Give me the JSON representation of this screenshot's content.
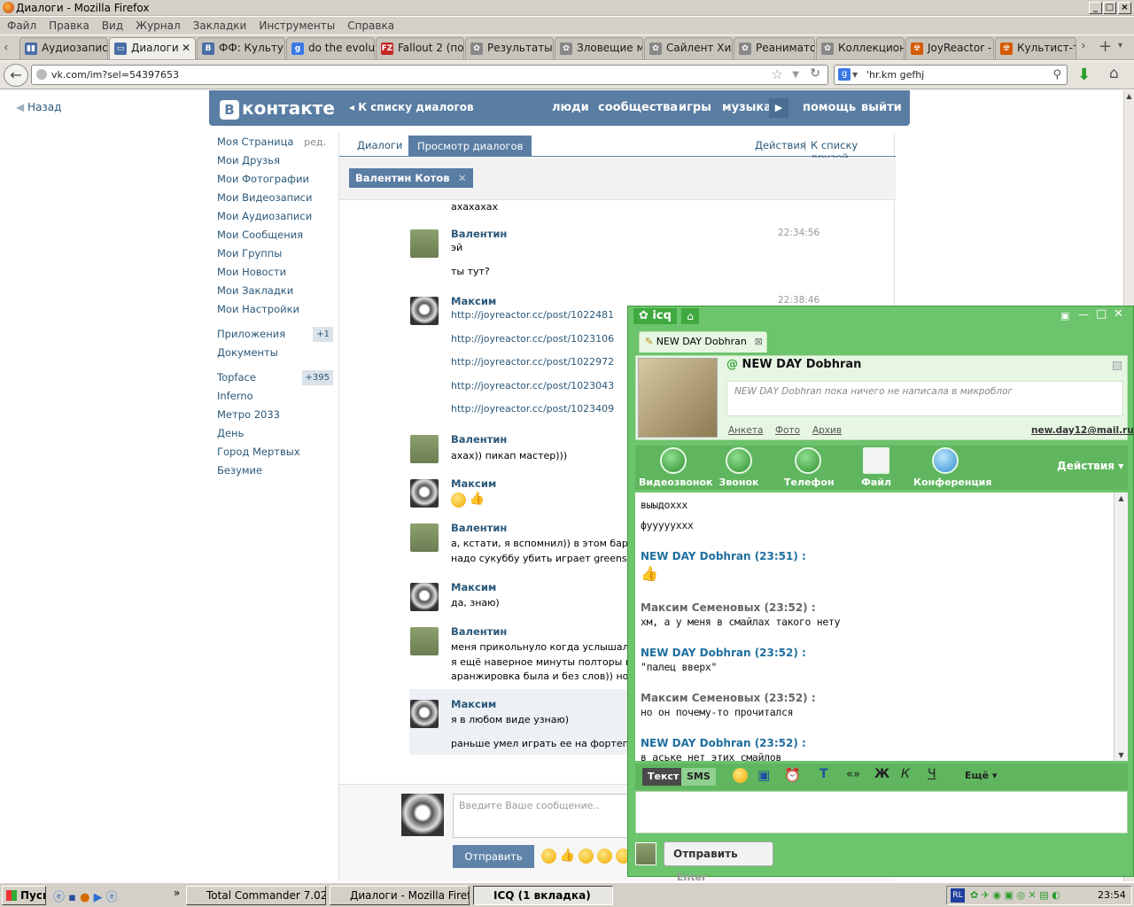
{
  "window": {
    "title": "Диалоги - Mozilla Firefox"
  },
  "menu": [
    "Файл",
    "Правка",
    "Вид",
    "Журнал",
    "Закладки",
    "Инструменты",
    "Справка"
  ],
  "tabs": [
    {
      "label": "Аудиозапис...",
      "icon": "vk"
    },
    {
      "label": "Диалоги",
      "icon": "vk"
    },
    {
      "label": "ФФ: Культу...",
      "icon": "vk"
    },
    {
      "label": "do the evolut...",
      "icon": "google"
    },
    {
      "label": "Fallout 2 (по...",
      "icon": "fz"
    },
    {
      "label": "Результаты ...",
      "icon": "gear"
    },
    {
      "label": "Зловещие м...",
      "icon": "gear"
    },
    {
      "label": "Сайлент Хилл",
      "icon": "gear"
    },
    {
      "label": "Реаниматор",
      "icon": "gear"
    },
    {
      "label": "Коллекцион...",
      "icon": "gear"
    },
    {
      "label": "JoyReactor - ...",
      "icon": "joy"
    },
    {
      "label": "Культист-тя...",
      "icon": "joy"
    }
  ],
  "nav": {
    "url": "vk.com/im?sel=54397653",
    "search": "'hr.km gefhj"
  },
  "vk": {
    "back": "Назад",
    "logo": "контакте",
    "logo_letter": "В",
    "to_dialogs": "К списку диалогов",
    "top_links": [
      "люди",
      "сообщества",
      "игры",
      "музыка",
      "помощь",
      "выйти"
    ],
    "left_nav": [
      {
        "label": "Моя Страница",
        "extra": "ред."
      },
      {
        "label": "Мои Друзья"
      },
      {
        "label": "Мои Фотографии"
      },
      {
        "label": "Мои Видеозаписи"
      },
      {
        "label": "Мои Аудиозаписи"
      },
      {
        "label": "Мои Сообщения"
      },
      {
        "label": "Мои Группы"
      },
      {
        "label": "Мои Новости"
      },
      {
        "label": "Мои Закладки"
      },
      {
        "label": "Мои Настройки"
      },
      {
        "label": "Приложения",
        "count": "+1"
      },
      {
        "label": "Документы"
      },
      {
        "label": "Topface",
        "count": "+395"
      },
      {
        "label": "Inferno"
      },
      {
        "label": "Метро 2033"
      },
      {
        "label": "День"
      },
      {
        "label": "Город Мертвых"
      },
      {
        "label": "Безумие"
      }
    ],
    "tab_dialogs": "Диалоги",
    "tab_view": "Просмотр диалогов",
    "actions": "Действия",
    "friends": "К списку друзей",
    "chip": "Валентин Котов",
    "messages": [
      {
        "text_top": "ахахахах"
      },
      {
        "name": "Валентин",
        "time": "22:34:56",
        "lines": [
          "эй",
          "ты тут?"
        ]
      },
      {
        "name": "Максим",
        "time": "22:38:46",
        "links": [
          "http://joyreactor.cc/post/1022481",
          "http://joyreactor.cc/post/1023106",
          "http://joyreactor.cc/post/1022972",
          "http://joyreactor.cc/post/1023043",
          "http://joyreactor.cc/post/1023409"
        ]
      },
      {
        "name": "Валентин",
        "lines": [
          "ахах)) пикап мастер)))"
        ]
      },
      {
        "name": "Максим",
        "emoji": true
      },
      {
        "name": "Валентин",
        "lines": [
          "а, кстати, я вспомнил)) в этом баре, в",
          "надо сукуббу убить играет greensleev"
        ]
      },
      {
        "name": "Максим",
        "lines": [
          "да, знаю)"
        ]
      },
      {
        "name": "Валентин",
        "lines": [
          "меня прикольнуло когда услышал))",
          "я ещё наверное минуты полторы вспо",
          "аранжировка была и без слов)) но всё"
        ]
      },
      {
        "name": "Максим",
        "lines": [
          "я в любом виде узнаю)",
          "раньше умел играть ее на фортепиан"
        ]
      }
    ],
    "input_placeholder": "Введите Ваше сообщение..",
    "send": "Отправить"
  },
  "icq": {
    "brand": "icq",
    "tab": "NEW DAY Dobhran",
    "name": "NEW DAY Dobhran",
    "microblog": "NEW DAY Dobhran пока ничего не написала в микроблог",
    "links": [
      "Анкета",
      "Фото",
      "Архив"
    ],
    "email": "new.day12@mail.ru",
    "calls": [
      "Видеозвонок",
      "Звонок",
      "Телефон",
      "Файл",
      "Конференция"
    ],
    "actions": "Действия",
    "messages": [
      {
        "type": "text",
        "text": "выыдохxx"
      },
      {
        "type": "text",
        "text": "фууууухxx"
      },
      {
        "type": "name",
        "text": "NEW DAY Dobhran (23:51) :",
        "color": "#1f6f9f"
      },
      {
        "type": "emoji"
      },
      {
        "type": "name",
        "text": "Максим Семеновых (23:52) :",
        "color": "#666666"
      },
      {
        "type": "text",
        "text": "хм, а у меня в смайлах такого нету"
      },
      {
        "type": "name",
        "text": "NEW DAY Dobhran (23:52) :",
        "color": "#1f6f9f"
      },
      {
        "type": "text",
        "text": "\"палец вверх\""
      },
      {
        "type": "name",
        "text": "Максим Семеновых (23:52) :",
        "color": "#666666"
      },
      {
        "type": "text",
        "text": "но он почему-то прочитался"
      },
      {
        "type": "name",
        "text": "NEW DAY Dobhran (23:52) :",
        "color": "#1f6f9f"
      },
      {
        "type": "text",
        "text": "в аське нет этих смайлов"
      }
    ],
    "tool": {
      "text": "Текст",
      "sms": "SMS",
      "more": "Ещё"
    },
    "send": "Отправить",
    "enter": "Enter"
  },
  "taskbar": {
    "start": "Пуск",
    "items": [
      "Total Commander 7.02a ...",
      "Диалоги - Mozilla Firefox",
      "ICQ (1 вкладка)"
    ],
    "lang": "RL",
    "clock": "23:54"
  }
}
